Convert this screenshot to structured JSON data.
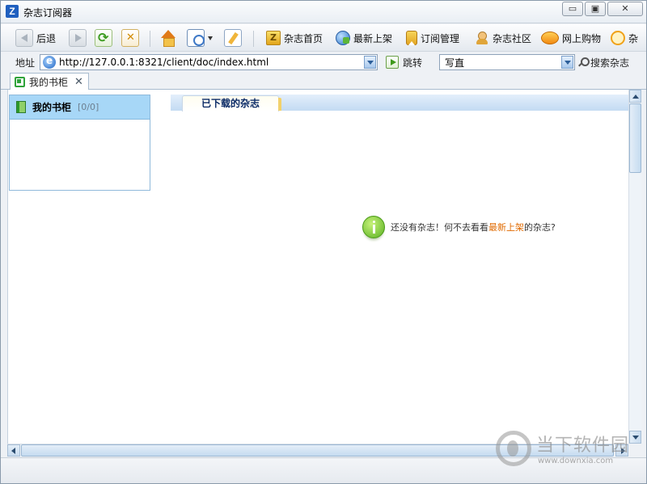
{
  "window": {
    "app_icon_letter": "Z",
    "title": "杂志订阅器",
    "minimize_glyph": "▭",
    "maximize_glyph": "▣",
    "close_glyph": "✕"
  },
  "toolbar": {
    "back_label": "后退",
    "home_label": "杂志首页",
    "latest_label": "最新上架",
    "subscription_label": "订阅管理",
    "community_label": "杂志社区",
    "shopping_label": "网上购物",
    "more_label": "杂"
  },
  "address": {
    "label": "地址",
    "url": "http://127.0.0.1:8321/client/doc/index.html",
    "jump_label": "跳转",
    "search_value": "写直",
    "search_label": "搜索杂志"
  },
  "tabs": [
    {
      "label": "我的书柜",
      "close": "✕"
    }
  ],
  "shelf": {
    "item_label": "我的书柜",
    "item_count": "[0/0]"
  },
  "main": {
    "tab_label": "已下载的杂志",
    "empty_prefix": "还没有杂志！何不去看看",
    "empty_link": "最新上架",
    "empty_suffix": "的杂志?"
  },
  "watermark": {
    "text": "当下软件园",
    "url": "www.downxia.com"
  },
  "colors": {
    "accent": "#1f5fbf",
    "link": "#e06a00",
    "shelf_selected": "#a7d7f7",
    "tab_text": "#0a2a66"
  }
}
